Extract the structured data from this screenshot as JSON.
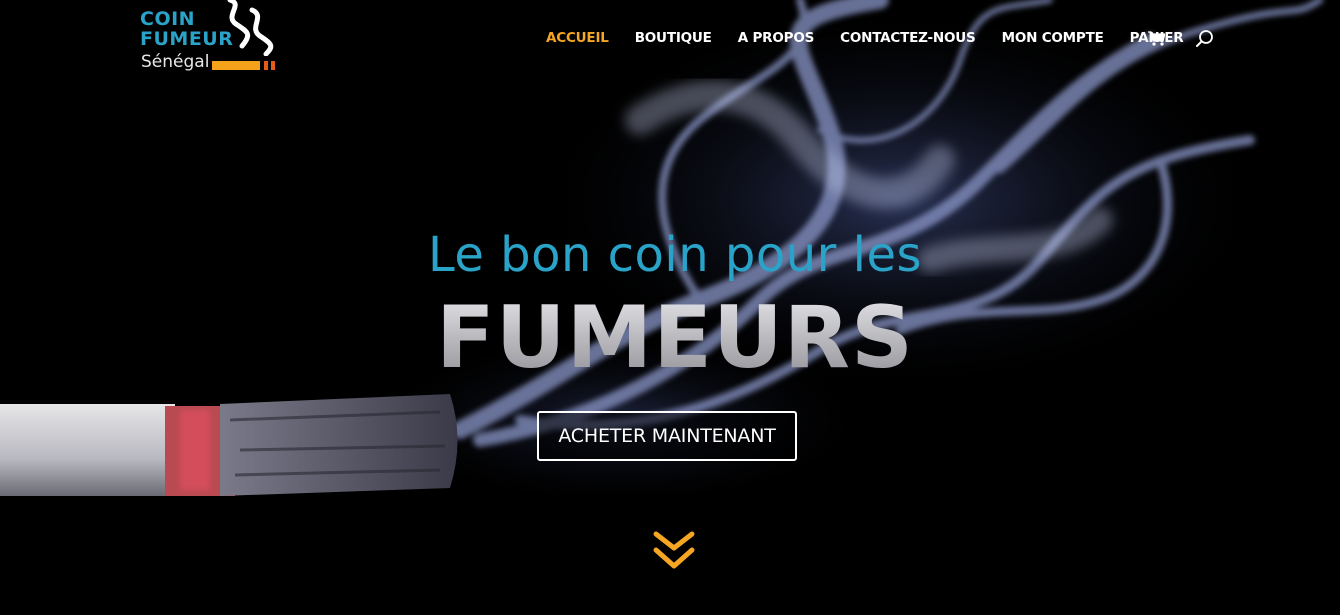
{
  "brand": {
    "line1": "COIN",
    "line2": "FUMEUR",
    "line3": "Sénégal",
    "colors": {
      "blue": "#2aa3c8",
      "orange": "#f4a21a",
      "red": "#e85a1a"
    }
  },
  "nav": {
    "items": [
      {
        "label": "ACCUEIL",
        "active": true
      },
      {
        "label": "BOUTIQUE",
        "active": false
      },
      {
        "label": "A PROPOS",
        "active": false
      },
      {
        "label": "CONTACTEZ-NOUS",
        "active": false
      },
      {
        "label": "MON COMPTE",
        "active": false
      },
      {
        "label": "PANIER",
        "active": false
      }
    ],
    "icons": [
      "cart-icon",
      "search-icon"
    ],
    "active_color": "#f5a623"
  },
  "hero": {
    "tagline": "Le bon coin pour les",
    "headline": "FUMEURS",
    "cta_label": "ACHETER MAINTENANT",
    "scroll_icon": "double-chevron-down-icon",
    "accent": "#f5a623"
  }
}
